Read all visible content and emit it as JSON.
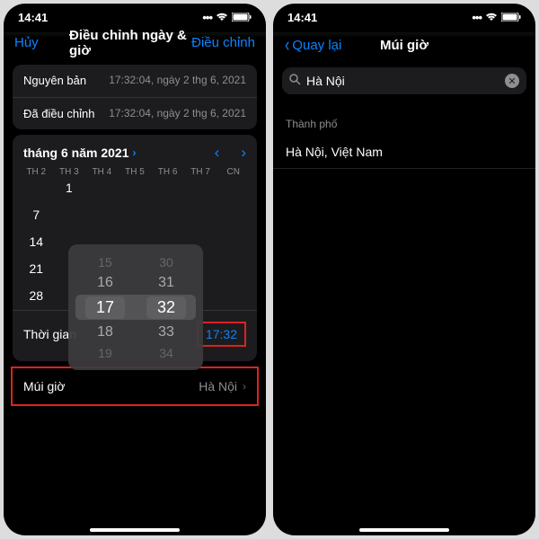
{
  "status": {
    "time": "14:41",
    "wifi": "􀙇",
    "battery": "􀛨"
  },
  "left": {
    "nav": {
      "cancel": "Hủy",
      "title": "Điều chỉnh ngày & giờ",
      "done": "Điều chỉnh"
    },
    "info": {
      "orig_label": "Nguyên bản",
      "orig_val": "17:32:04, ngày 2 thg 6, 2021",
      "adj_label": "Đã điều chỉnh",
      "adj_val": "17:32:04, ngày 2 thg 6, 2021"
    },
    "calendar": {
      "month": "tháng 6 năm 2021",
      "dow": [
        "TH 2",
        "TH 3",
        "TH 4",
        "TH 5",
        "TH 6",
        "TH 7",
        "CN"
      ],
      "days": [
        "",
        "1",
        "",
        "",
        "",
        "",
        "",
        "7",
        "",
        "",
        "",
        "",
        "",
        "",
        "14",
        "",
        "",
        "",
        "",
        "",
        "",
        "21",
        "",
        "",
        "",
        "",
        "",
        "",
        "28",
        ""
      ]
    },
    "picker": {
      "hours": [
        "15",
        "16",
        "17",
        "18",
        "19"
      ],
      "mins": [
        "30",
        "31",
        "32",
        "33",
        "34"
      ]
    },
    "time_label": "Thời gian",
    "time_val": "17:32",
    "tz_label": "Múi giờ",
    "tz_val": "Hà Nội"
  },
  "right": {
    "nav": {
      "back": "Quay lại",
      "title": "Múi giờ"
    },
    "search": {
      "value": "Hà Nội"
    },
    "section": "Thành phố",
    "result": "Hà Nội, Việt Nam"
  }
}
